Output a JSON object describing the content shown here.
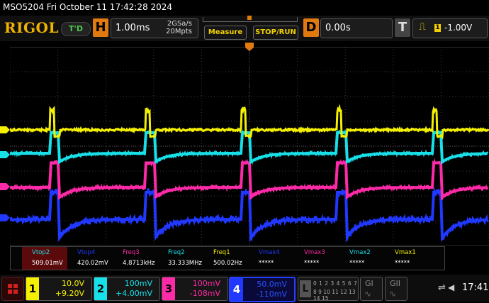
{
  "title_line": "MSO5204  Fri October 11 17:42:28 2024",
  "logo": "RIGOL",
  "trigger_status": "T'D",
  "horizontal": {
    "key": "H",
    "timebase": "1.00ms",
    "sample_rate": "2GSa/s",
    "memory_depth": "20Mpts"
  },
  "buttons": {
    "measure": "Measure",
    "stop_run": "STOP/RUN"
  },
  "delay": {
    "key": "D",
    "value": "0.00s"
  },
  "trigger": {
    "key": "T",
    "edge_icon": "rising-edge",
    "source": "1",
    "level": "-1.00V"
  },
  "colors": {
    "ch1": "#f4f000",
    "ch2": "#18e0e8",
    "ch3": "#ff2aa8",
    "ch4": "#2038ff",
    "accent": "#e07a10"
  },
  "measurements": [
    {
      "label": "Vtop2",
      "value": "509.01mV",
      "color": "#18e0e8",
      "highlight": true
    },
    {
      "label": "Vtop4",
      "value": "420.02mV",
      "color": "#2038ff"
    },
    {
      "label": "Freq3",
      "value": "4.8713kHz",
      "color": "#ff2aa8"
    },
    {
      "label": "Freq2",
      "value": "33.333MHz",
      "color": "#18e0e8"
    },
    {
      "label": "Freq1",
      "value": "500.02Hz",
      "color": "#f4f000"
    },
    {
      "label": "Vmax4",
      "value": "*****",
      "color": "#2038ff"
    },
    {
      "label": "Vmax3",
      "value": "*****",
      "color": "#ff2aa8"
    },
    {
      "label": "Vmax2",
      "value": "*****",
      "color": "#18e0e8"
    },
    {
      "label": "Vmax1",
      "value": "*****",
      "color": "#f4f000"
    }
  ],
  "channels": [
    {
      "num": "1",
      "scale": "10.0V",
      "offset": "+9.20V",
      "color": "#f4f000"
    },
    {
      "num": "2",
      "scale": "100mV",
      "offset": "+4.00mV",
      "color": "#18e0e8"
    },
    {
      "num": "3",
      "scale": "100mV",
      "offset": "-108mV",
      "color": "#ff2aa8"
    },
    {
      "num": "4",
      "scale": "50.0mV",
      "offset": "-110mV",
      "color": "#2038ff",
      "selected": true
    }
  ],
  "logic": {
    "key": "L",
    "row1": "0 1 2 3 4 5 6 7",
    "row2": "8 9 10 11 12 13 14 15"
  },
  "generators": [
    {
      "label": "GI"
    },
    {
      "label": "GII"
    }
  ],
  "status": {
    "time": "17:41"
  }
}
